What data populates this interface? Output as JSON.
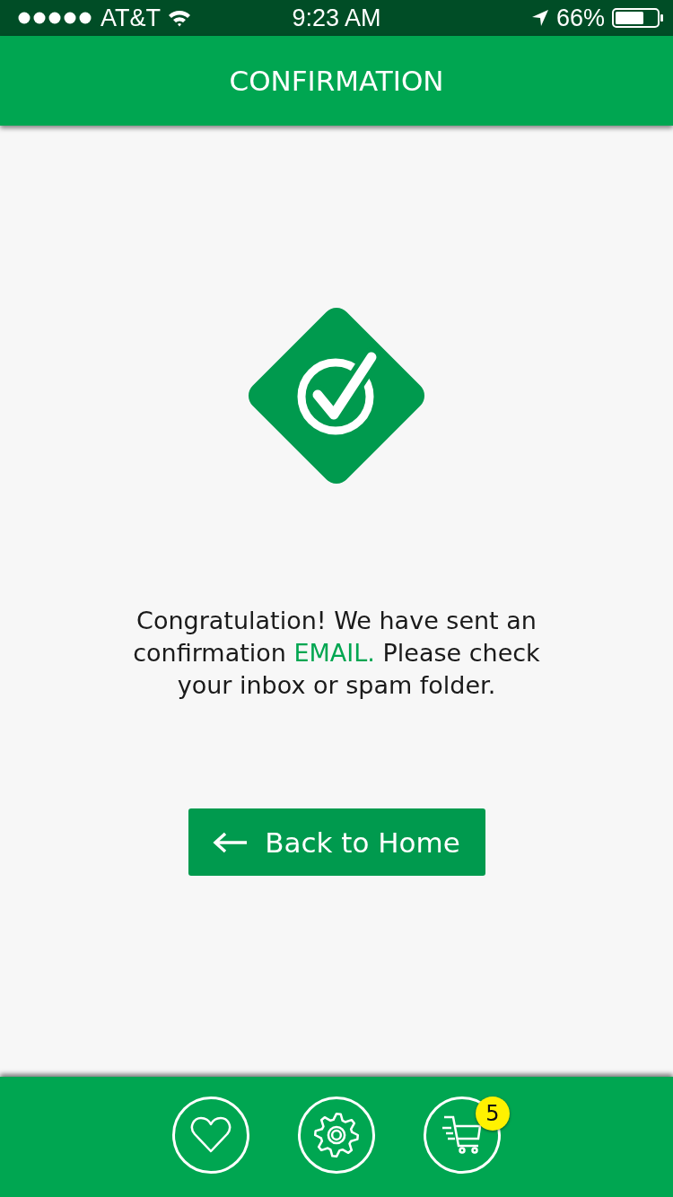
{
  "status_bar": {
    "carrier": "AT&T",
    "time": "9:23 AM",
    "battery": "66%"
  },
  "header": {
    "title": "CONFIRMATION"
  },
  "message": {
    "before": "Congratulation! We have sent an confirmation ",
    "highlight": "EMAIL.",
    "after": " Please check your inbox or spam folder."
  },
  "button": {
    "label": "Back to Home"
  },
  "tab_bar": {
    "cart_badge": "5"
  }
}
